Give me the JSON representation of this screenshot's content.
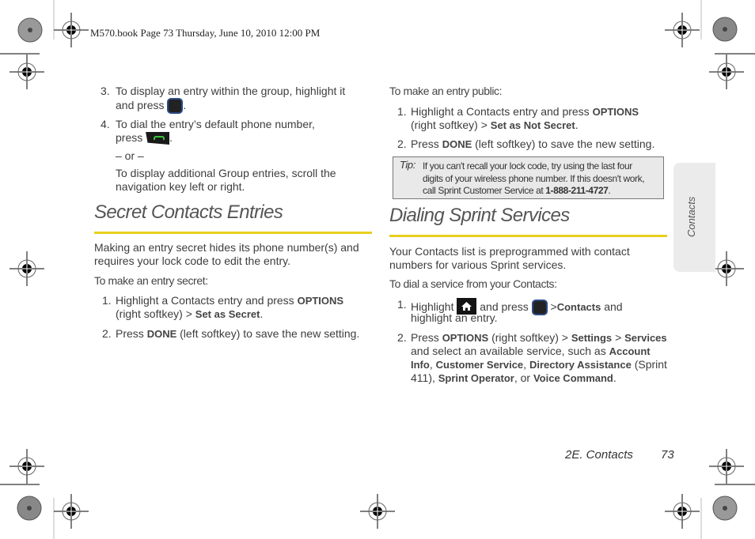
{
  "header": {
    "slug": "M570.book  Page 73  Thursday, June 10, 2010  12:00 PM"
  },
  "left_column": {
    "steps_top": [
      {
        "num": "3.",
        "line1": "To display an entry within the group, highlight it",
        "line2_pre": "and press",
        "line2_post": ".",
        "icon": "menu-ok-key-icon"
      },
      {
        "num": "4.",
        "line1": "To dial the entry’s default phone number,",
        "line2_pre": "press",
        "line2_post": ".",
        "icon": "talk-key-icon"
      }
    ],
    "or_text": "– or –",
    "alt_text_line1": "To display additional Group entries, scroll the",
    "alt_text_line2": "navigation key left or right.",
    "section_title": "Secret Contacts Entries",
    "intro_line1": "Making an entry secret hides its phone number(s) and",
    "intro_line2": "requires your lock code to edit the entry.",
    "lead": "To make an entry secret:",
    "steps": [
      {
        "num": "1.",
        "line1_pre": "Highlight a Contacts entry and press ",
        "line1_bold": "OPTIONS",
        "line2_pre": "(right softkey) ",
        "sep": ">",
        "line2_bold": "Set as Secret",
        "line2_post": "."
      },
      {
        "num": "2.",
        "pre": "Press ",
        "bold": "DONE",
        "post": " (left softkey) to save the new setting."
      }
    ]
  },
  "right_column": {
    "lead_public": "To make an entry public:",
    "steps_public": [
      {
        "num": "1.",
        "line1_pre": "Highlight a Contacts entry and press ",
        "line1_bold": "OPTIONS",
        "line2_pre": "(right softkey) ",
        "sep": ">",
        "line2_bold": "Set as Not Secret",
        "line2_post": "."
      },
      {
        "num": "2.",
        "pre": "Press ",
        "bold": "DONE",
        "post": " (left softkey) to save the new setting."
      }
    ],
    "tip": {
      "label": "Tip:",
      "line1": "If you can't recall your lock code, try using the last four",
      "line2": "digits of your wireless phone number. If this doesn't work,",
      "line3_pre": "call Sprint Customer Service at ",
      "line3_bold": "1-888-211-4727",
      "line3_post": "."
    },
    "section_title": "Dialing Sprint Services",
    "intro_line1": "Your Contacts list is preprogrammed with contact",
    "intro_line2": "numbers for various Sprint services.",
    "lead": "To dial a service from your Contacts:",
    "steps": [
      {
        "num": "1.",
        "pre": "Highlight",
        "mid": "and press",
        "sep": ">",
        "bold": "Contacts",
        "post": " and",
        "line2": "highlight an entry."
      },
      {
        "num": "2.",
        "l1_pre": "Press ",
        "l1_b1": "OPTIONS",
        "l1_mid": " (right softkey) ",
        "sep": ">",
        "l1_b2": "Settings",
        "l1_b3": "Services",
        "l2_pre": "and select an available service, such as ",
        "l2_b": "Account",
        "l3_b1": "Info",
        "l3_c1": ", ",
        "l3_b2": "Customer Service",
        "l3_c2": ", ",
        "l3_b3": "Directory Assistance",
        "l3_post": " (Sprint",
        "l4_pre": "411), ",
        "l4_b1": "Sprint Operator",
        "l4_mid": ", or ",
        "l4_b2": "Voice Command",
        "l4_post": "."
      }
    ]
  },
  "side_tab": {
    "label": "Contacts"
  },
  "footer": {
    "section": "2E. Contacts",
    "page": "73"
  },
  "colors": {
    "accent_rule": "#e8cf1e",
    "tip_bg": "#e9e9e9",
    "tab_bg": "#ebebeb",
    "talk_key_green": "#3bc43b",
    "key_border_blue": "#2c4a86"
  }
}
